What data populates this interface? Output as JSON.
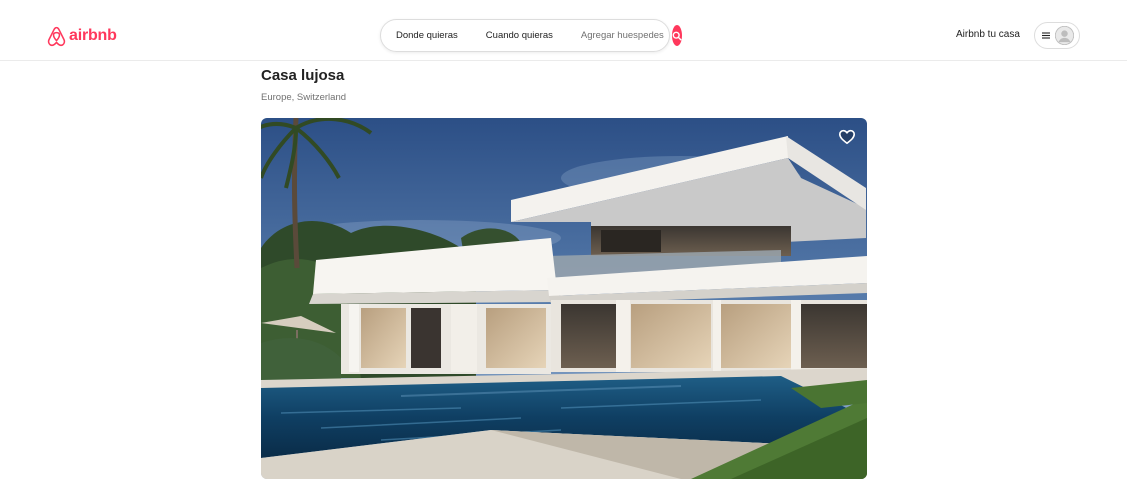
{
  "header": {
    "brand": "airbnb",
    "search": {
      "where": "Donde quieras",
      "when": "Cuando quieras",
      "guests": "Agregar huespedes"
    },
    "host_link": "Airbnb tu casa",
    "icons": {
      "logo": "airbnb-logo-icon",
      "search": "search-icon",
      "menu": "hamburger-menu-icon",
      "avatar": "user-avatar-icon"
    }
  },
  "listing": {
    "title": "Casa lujosa",
    "location": "Europe, Switzerland",
    "photo_icon": "heart-icon"
  },
  "colors": {
    "brand": "#ff385c",
    "text": "#222222",
    "muted": "#717171",
    "border": "#dddddd"
  }
}
